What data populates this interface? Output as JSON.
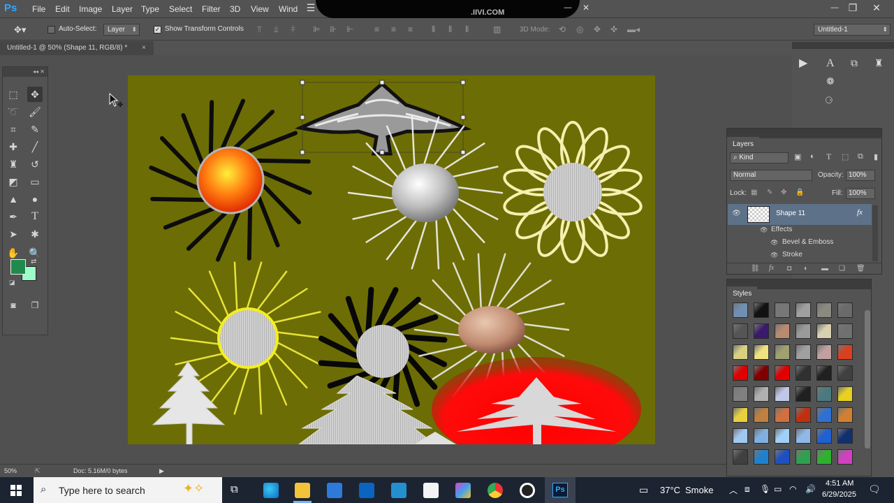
{
  "app": {
    "logo": "Ps",
    "menus": [
      "File",
      "Edit",
      "Image",
      "Layer",
      "Type",
      "Select",
      "Filter",
      "3D",
      "View",
      "Wind"
    ],
    "window_controls": {
      "menu_glyph": "☰",
      "minimize": "—",
      "restore": "❐",
      "close": "✕",
      "inner_min": "—",
      "inner_close": "✕"
    },
    "redacted_peek": ".IIVI.COM"
  },
  "options_bar": {
    "auto_select_label": "Auto-Select:",
    "auto_select_checked": false,
    "auto_select_target": "Layer",
    "show_transform_label": "Show Transform Controls",
    "show_transform_checked": true,
    "mode_3d_label": "3D Mode:",
    "workspace": "Untitled-1"
  },
  "document_tab": {
    "title": "Untitled-1 @ 50% (Shape 11, RGB/8) *",
    "close": "×"
  },
  "colors": {
    "foreground": "#1f8a4c",
    "background": "#9dfcc9",
    "canvas": "#6d6d05",
    "selected_layer": "#5d7188"
  },
  "tools": [
    "marquee-icon",
    "move-icon",
    "lasso-icon",
    "quick-select-icon",
    "crop-icon",
    "eyedropper-icon",
    "healing-icon",
    "brush-icon",
    "clone-stamp-icon",
    "history-brush-icon",
    "eraser-icon",
    "gradient-icon",
    "blur-icon",
    "dodge-icon",
    "pen-icon",
    "type-icon",
    "path-select-icon",
    "shape-icon",
    "hand-icon",
    "zoom-icon",
    "quick-mask-icon",
    "screen-mode-icon"
  ],
  "status_bar": {
    "zoom": "50%",
    "doc_info": "Doc: 5.16M/0 bytes"
  },
  "layers_panel": {
    "title": "Layers",
    "filter": "Kind",
    "blend_mode": "Normal",
    "opacity_label": "Opacity:",
    "opacity": "100%",
    "lock_label": "Lock:",
    "fill_label": "Fill:",
    "fill": "100%",
    "layer_name": "Shape 11",
    "fx_label": "fx",
    "effects_label": "Effects",
    "effects": [
      "Bevel & Emboss",
      "Stroke"
    ]
  },
  "styles_panel": {
    "title": "Styles",
    "swatches": [
      "#6f8fb3",
      "#111111",
      "#777777",
      "#a0a0a0",
      "#8a8a80",
      "#6a6a6a",
      "#555555",
      "#3a1a6a",
      "#b88a70",
      "#9a9a9a",
      "#d8d0b0",
      "#707070",
      "#d8d080",
      "#f0e080",
      "#a0a070",
      "#a0a0a0",
      "#c0a0a0",
      "#d84020",
      "#e00000",
      "#800000",
      "#e00000",
      "#303030",
      "#202020",
      "#404040",
      "#808080",
      "#b0b0b0",
      "#c0c8e8",
      "#202020",
      "#4a7a80",
      "#e8d020",
      "#e8d040",
      "#c08040",
      "#d07040",
      "#c03010",
      "#3070d0",
      "#d08030",
      "#a0c8f0",
      "#80b0e0",
      "#a0d0f8",
      "#90b8e8",
      "#2060d0",
      "#103070",
      "#404040",
      "#2080d0",
      "#2050c0",
      "#30a050",
      "#30b030",
      "#d040c0"
    ]
  },
  "taskbar": {
    "search_placeholder": "Type here to search",
    "weather_temp": "37°C",
    "weather_desc": "Smoke",
    "time": "4:51 AM",
    "date": "6/29/2025"
  }
}
